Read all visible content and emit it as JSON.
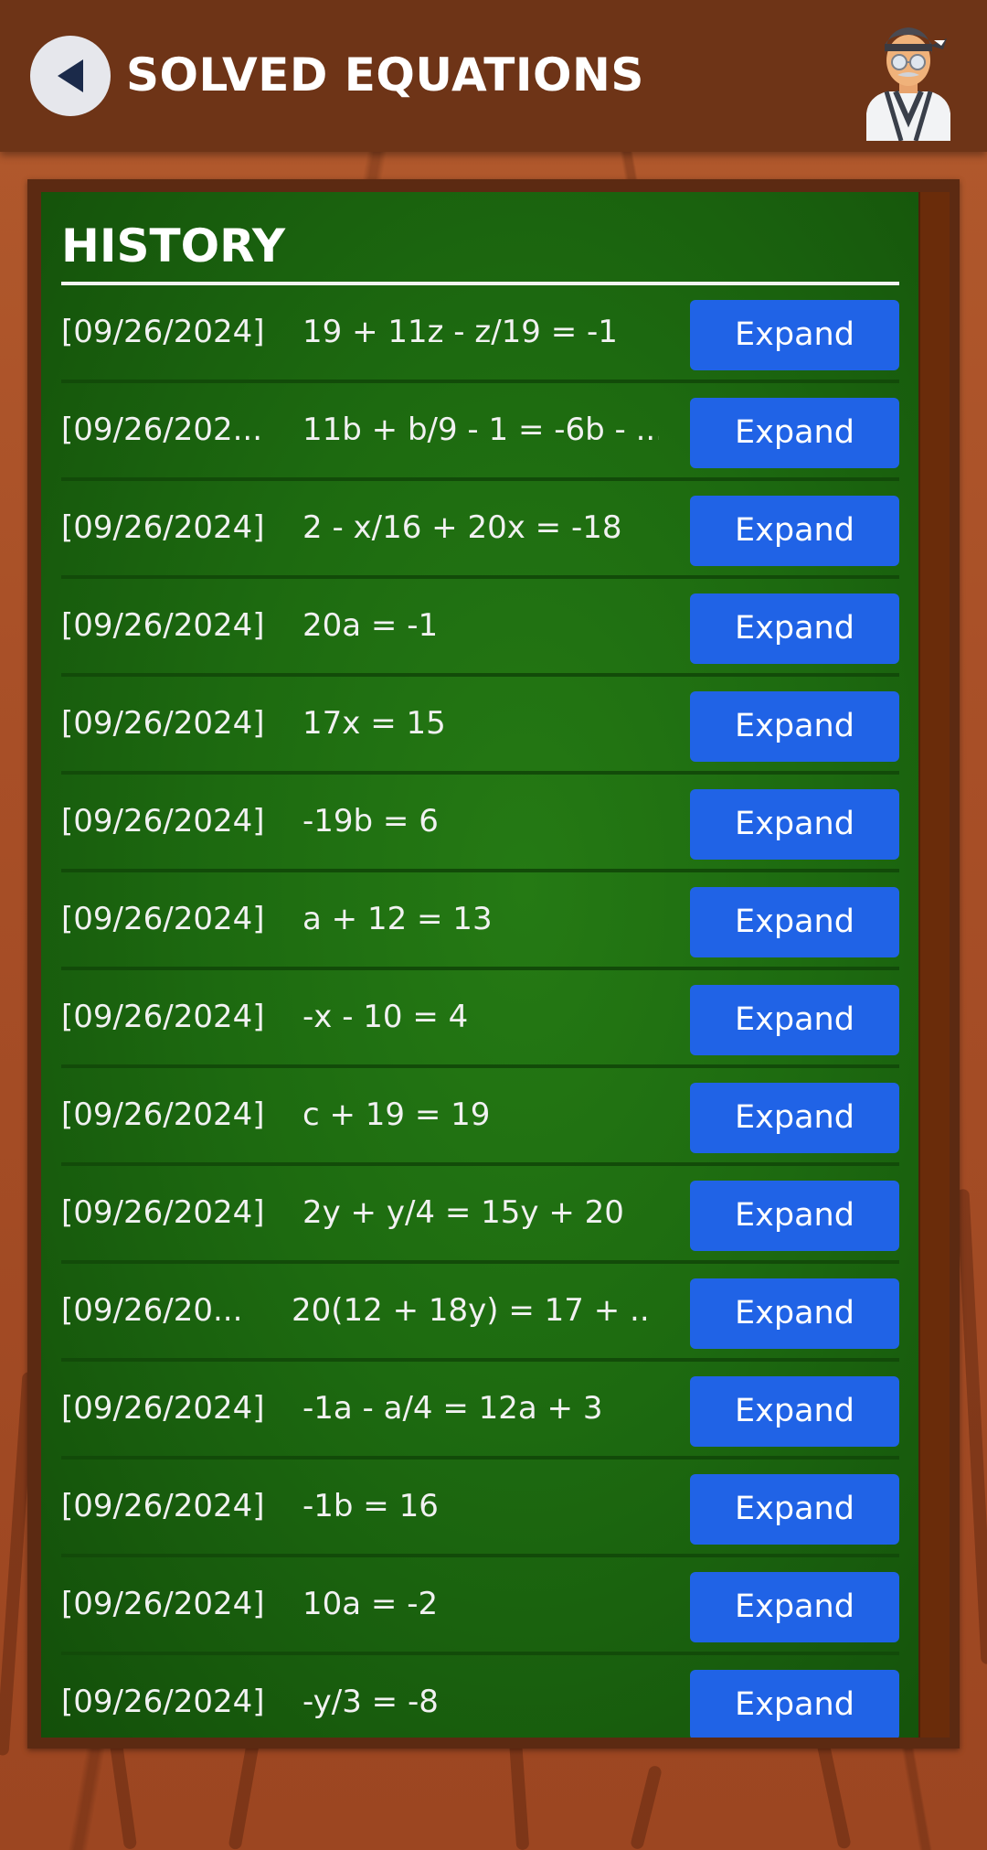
{
  "header": {
    "title": "SOLVED EQUATIONS",
    "back_icon": "back-arrow-icon",
    "avatar_icon": "ninja-teacher-avatar"
  },
  "history": {
    "title": "HISTORY",
    "items": [
      {
        "date": "[09/26/2024]",
        "equation": "19 + 11z - z/19 = -1",
        "button": "Expand"
      },
      {
        "date": "[09/26/202...",
        "equation": "11b + b/9 - 1 = -6b - ...",
        "button": "Expand"
      },
      {
        "date": "[09/26/2024]",
        "equation": "2 - x/16 + 20x = -18",
        "button": "Expand"
      },
      {
        "date": "[09/26/2024]",
        "equation": "20a = -1",
        "button": "Expand"
      },
      {
        "date": "[09/26/2024]",
        "equation": "17x = 15",
        "button": "Expand"
      },
      {
        "date": "[09/26/2024]",
        "equation": "-19b = 6",
        "button": "Expand"
      },
      {
        "date": "[09/26/2024]",
        "equation": "a + 12 = 13",
        "button": "Expand"
      },
      {
        "date": "[09/26/2024]",
        "equation": "-x - 10 = 4",
        "button": "Expand"
      },
      {
        "date": "[09/26/2024]",
        "equation": "c + 19 = 19",
        "button": "Expand"
      },
      {
        "date": "[09/26/2024]",
        "equation": "2y + y/4 = 15y + 20",
        "button": "Expand"
      },
      {
        "date": "[09/26/20...",
        "equation": "20(12 + 18y) = 17 + ...",
        "button": "Expand"
      },
      {
        "date": "[09/26/2024]",
        "equation": "-1a - a/4 = 12a + 3",
        "button": "Expand"
      },
      {
        "date": "[09/26/2024]",
        "equation": "-1b = 16",
        "button": "Expand"
      },
      {
        "date": "[09/26/2024]",
        "equation": "10a = -2",
        "button": "Expand"
      },
      {
        "date": "[09/26/2024]",
        "equation": "-y/3 = -8",
        "button": "Expand"
      }
    ]
  },
  "colors": {
    "header_bg": "#6e3417",
    "board_green": "#1d6a10",
    "button_blue": "#2063e6",
    "wood": "#a84f27"
  }
}
